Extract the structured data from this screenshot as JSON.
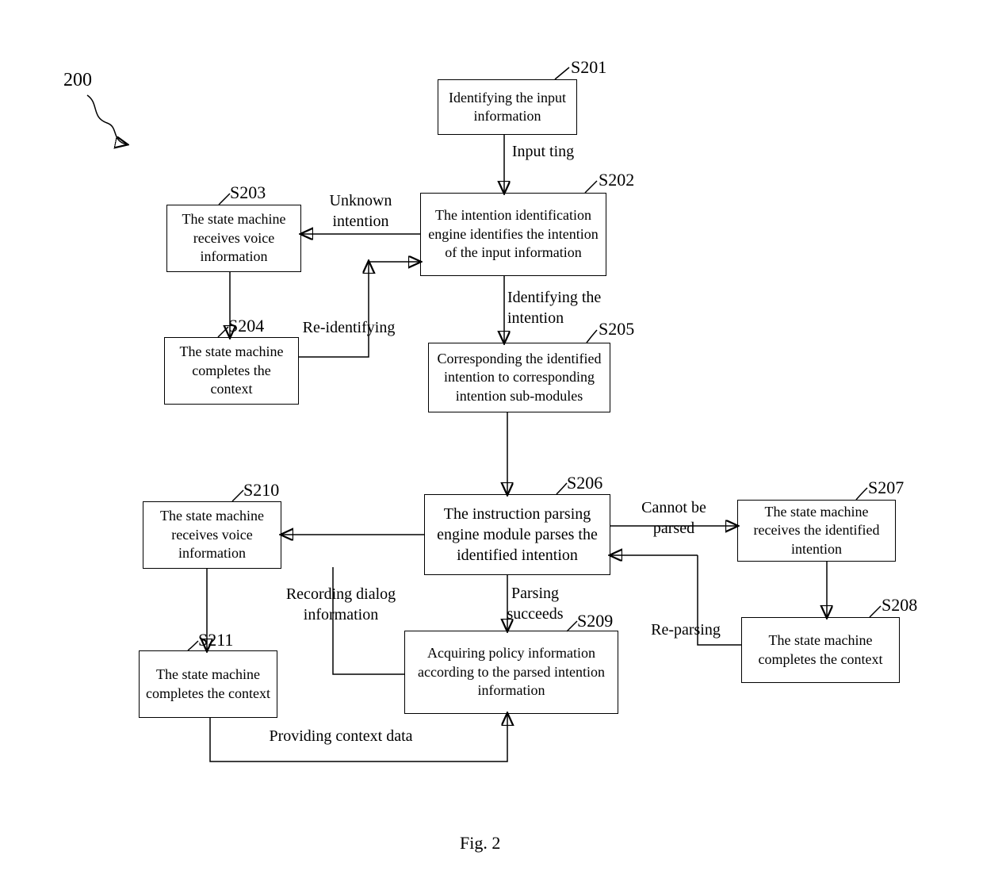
{
  "figure_label_200": "200",
  "figure_caption": "Fig. 2",
  "nodes": {
    "s201": {
      "tag": "S201",
      "text": "Identifying the input information"
    },
    "s202": {
      "tag": "S202",
      "text": "The intention identification engine identifies the intention of the input information"
    },
    "s203": {
      "tag": "S203",
      "text": "The state machine receives voice information"
    },
    "s204": {
      "tag": "S204",
      "text": "The state machine completes the context"
    },
    "s205": {
      "tag": "S205",
      "text": "Corresponding the identified intention to corresponding intention sub-modules"
    },
    "s206": {
      "tag": "S206",
      "text": "The instruction parsing engine module parses the identified intention"
    },
    "s207": {
      "tag": "S207",
      "text": "The state machine receives the identified intention"
    },
    "s208": {
      "tag": "S208",
      "text": "The state machine completes the context"
    },
    "s209": {
      "tag": "S209",
      "text": "Acquiring policy information according to the parsed intention information"
    },
    "s210": {
      "tag": "S210",
      "text": "The state machine receives voice information"
    },
    "s211": {
      "tag": "S211",
      "text": "The state machine completes the context"
    }
  },
  "edges": {
    "input_ting": "Input ting",
    "unknown_intention": "Unknown intention",
    "re_identifying": "Re-identifying",
    "identifying_the_intention": "Identifying  the intention",
    "cannot_be_parsed": "Cannot be parsed",
    "re_parsing": "Re-parsing",
    "parsing_succeeds": "Parsing succeeds",
    "recording_dialog_information": "Recording dialog information",
    "providing_context_data": "Providing context data"
  }
}
